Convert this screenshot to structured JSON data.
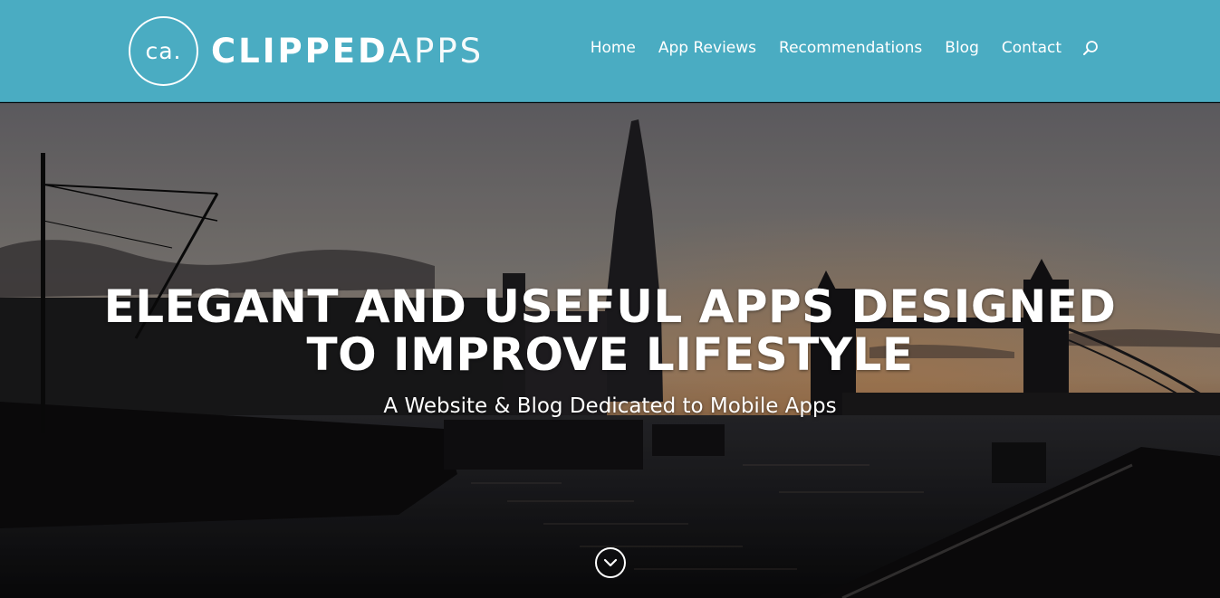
{
  "header": {
    "logo_mark": "ca.",
    "logo_bold": "CLIPPED",
    "logo_light": "APPS",
    "background_color": "#4aacc2"
  },
  "nav": {
    "items": [
      {
        "label": "Home"
      },
      {
        "label": "App Reviews"
      },
      {
        "label": "Recommendations"
      },
      {
        "label": "Blog"
      },
      {
        "label": "Contact"
      }
    ],
    "search_icon": "search-icon"
  },
  "hero": {
    "title_line1": "ELEGANT AND USEFUL APPS DESIGNED",
    "title_line2": "TO IMPROVE LIFESTYLE",
    "subtitle": "A Website & Blog Dedicated to Mobile Apps",
    "scroll_icon": "chevron-down-icon",
    "background_image": "london-skyline-thames-sunset"
  }
}
